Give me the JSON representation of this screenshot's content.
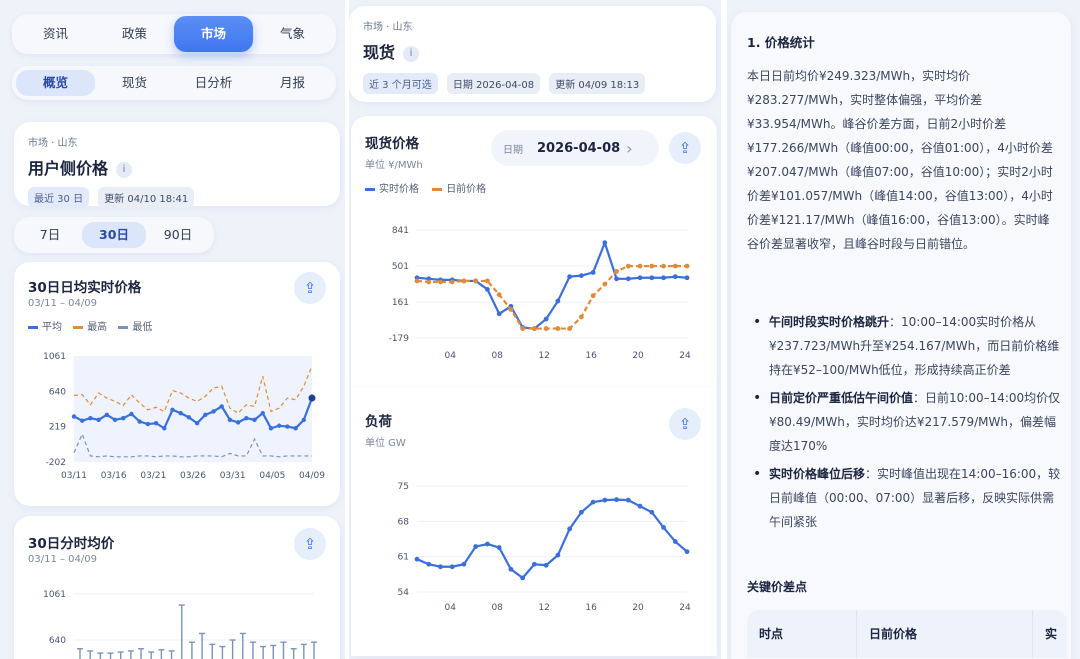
{
  "panel1": {
    "tabs": [
      "资讯",
      "政策",
      "市场",
      "气象"
    ],
    "active_tab": 2,
    "subtabs": [
      "概览",
      "现货",
      "日分析",
      "月报"
    ],
    "active_subtab": 0,
    "crumb": "市场 · 山东",
    "title": "用户侧价格",
    "info": "i",
    "tag_range": "最近 30 日",
    "tag_updated": "更新 04/10 18:41",
    "ranges": [
      "7日",
      "30日",
      "90日"
    ],
    "active_range": 1,
    "card1": {
      "title": "30日日均实时价格",
      "date_range": "03/11 – 04/09",
      "legend": [
        "平均",
        "最高",
        "最低"
      ],
      "share": "⇪"
    },
    "card2": {
      "title": "30日分时均价",
      "date_range": "03/11 – 04/09",
      "share": "⇪"
    }
  },
  "panel2": {
    "crumb": "市场 · 山东",
    "title": "现货",
    "info": "i",
    "tag_range": "近 3 个月可选",
    "tag_date": "日期 2026-04-08",
    "tag_updated": "更新 04/09 18:13",
    "price_card": {
      "title": "现货价格",
      "unit": "单位 ¥/MWh",
      "date_label": "日期",
      "date_value": "2026-04-08",
      "chevron": "›",
      "legend": [
        "实时价格",
        "日前价格"
      ],
      "share": "⇪"
    },
    "load_card": {
      "title": "负荷",
      "unit": "单位 GW",
      "share": "⇪"
    }
  },
  "panel3": {
    "heading": "1. 价格统计",
    "para": "本日日前均价¥249.323/MWh，实时均价¥283.277/MWh，实时整体偏强，平均价差¥33.954/MWh。峰谷价差方面，日前2小时价差¥177.266/MWh（峰值00:00，谷值01:00），4小时价差¥207.047/MWh（峰值07:00，谷值10:00）；实时2小时价差¥101.057/MWh（峰值14:00，谷值13:00），4小时价差¥121.17/MWh（峰值16:00，谷值13:00）。实时峰谷价差显著收窄，且峰谷时段与日前错位。",
    "bullets": [
      {
        "bold": "午间时段实时价格跳升",
        "text": "：10:00–14:00实时价格从¥237.723/MWh升至¥254.167/MWh，而日前价格维持在¥52–100/MWh低位，形成持续高正价差"
      },
      {
        "bold": "日前定价严重低估午间价值",
        "text": "：日前10:00–14:00均价仅¥80.49/MWh，实时均价达¥217.579/MWh，偏差幅度达170%"
      },
      {
        "bold": "实时价格峰位后移",
        "text": "：实时峰值出现在14:00–16:00，较日前峰值（00:00、07:00）显著后移，反映实际供需午间紧张"
      }
    ],
    "sub_heading": "关键价差点",
    "table_headers": [
      "时点",
      "日前价格",
      "实"
    ]
  },
  "colors": {
    "blue": "#3a6fdc",
    "orange": "#e08a3c",
    "slate": "#7b93b8",
    "accent": "#4a80f0"
  },
  "chart_data": [
    {
      "id": "daily-30",
      "type": "line",
      "title": "30日日均实时价格",
      "xlabel": "",
      "ylabel": "",
      "x_ticks": [
        "03/11",
        "03/16",
        "03/21",
        "03/26",
        "03/31",
        "04/05",
        "04/09"
      ],
      "y_ticks": [
        -202,
        219,
        640,
        1061
      ],
      "ylim": [
        -202,
        1061
      ],
      "series": [
        {
          "name": "平均",
          "values": [
            340,
            290,
            320,
            300,
            360,
            300,
            320,
            370,
            280,
            250,
            260,
            200,
            420,
            380,
            330,
            260,
            360,
            400,
            460,
            300,
            270,
            320,
            300,
            380,
            200,
            230,
            220,
            200,
            300,
            560
          ]
        },
        {
          "name": "最高",
          "values": [
            590,
            600,
            480,
            620,
            560,
            520,
            470,
            600,
            500,
            420,
            450,
            400,
            650,
            620,
            560,
            520,
            580,
            680,
            700,
            440,
            380,
            480,
            460,
            820,
            400,
            440,
            560,
            540,
            700,
            940
          ]
        },
        {
          "name": "最低",
          "values": [
            -90,
            130,
            -130,
            -140,
            -130,
            -140,
            -140,
            -140,
            -130,
            -130,
            -140,
            -130,
            -130,
            -140,
            -140,
            -130,
            -130,
            -130,
            -140,
            -100,
            -130,
            -130,
            70,
            -130,
            -130,
            -140,
            -130,
            -130,
            -130,
            -130
          ]
        }
      ]
    },
    {
      "id": "hourly-30",
      "type": "bar",
      "title": "30日分时均价",
      "y_ticks": [
        640,
        1061
      ],
      "ylim": [
        -202,
        1061
      ],
      "series": [
        {
          "name": "",
          "values": [
            560,
            540,
            520,
            520,
            530,
            540,
            560,
            530,
            550,
            540,
            960,
            620,
            700,
            600,
            580,
            640,
            700,
            620,
            580,
            590,
            620,
            560,
            600,
            620
          ]
        }
      ]
    },
    {
      "id": "spot-price",
      "type": "line",
      "title": "现货价格",
      "x_ticks": [
        "04",
        "08",
        "12",
        "16",
        "20",
        "24"
      ],
      "y_ticks": [
        -179,
        161,
        501,
        841
      ],
      "ylim": [
        -179,
        841
      ],
      "x": [
        1,
        2,
        3,
        4,
        5,
        6,
        7,
        8,
        9,
        10,
        11,
        12,
        13,
        14,
        15,
        16,
        17,
        18,
        19,
        20,
        21,
        22,
        23,
        24
      ],
      "series": [
        {
          "name": "实时价格",
          "values": [
            390,
            380,
            370,
            370,
            360,
            360,
            280,
            50,
            120,
            -80,
            -90,
            0,
            170,
            400,
            410,
            440,
            720,
            380,
            380,
            390,
            390,
            390,
            400,
            390
          ]
        },
        {
          "name": "日前价格",
          "values": [
            360,
            350,
            350,
            350,
            360,
            360,
            360,
            230,
            90,
            -90,
            -90,
            -90,
            -90,
            -90,
            20,
            220,
            330,
            450,
            500,
            500,
            500,
            500,
            500,
            500
          ]
        }
      ]
    },
    {
      "id": "load",
      "type": "line",
      "title": "负荷",
      "x_ticks": [
        "04",
        "08",
        "12",
        "16",
        "20",
        "24"
      ],
      "y_ticks": [
        54,
        61,
        68,
        75
      ],
      "ylim": [
        54,
        75
      ],
      "x": [
        1,
        2,
        3,
        4,
        5,
        6,
        7,
        8,
        9,
        10,
        11,
        12,
        13,
        14,
        15,
        16,
        17,
        18,
        19,
        20,
        21,
        22,
        23,
        24
      ],
      "series": [
        {
          "name": "",
          "values": [
            60.5,
            59.5,
            59,
            59,
            59.5,
            63,
            63.5,
            62.8,
            58.5,
            56.8,
            59.5,
            59.3,
            61.3,
            66.5,
            69.8,
            71.8,
            72.2,
            72.3,
            72.2,
            71,
            69.8,
            66.8,
            64,
            62
          ]
        }
      ]
    }
  ]
}
